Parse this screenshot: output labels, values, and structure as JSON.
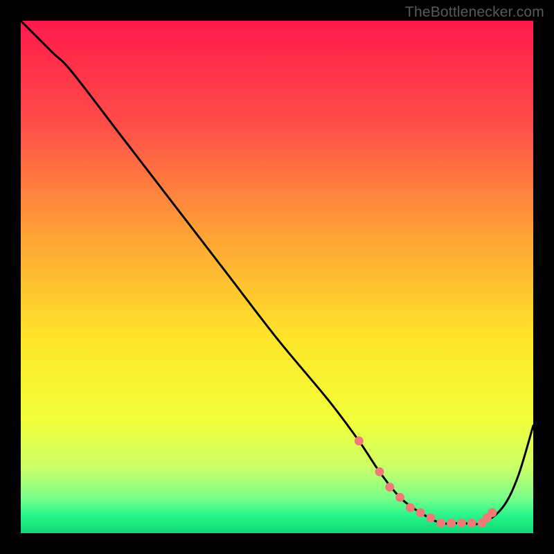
{
  "attribution": "TheBottlenecker.com",
  "colors": {
    "black": "#000000",
    "curve": "#000000",
    "dot": "#ee7b78"
  },
  "chart_data": {
    "type": "line",
    "title": "",
    "xlabel": "",
    "ylabel": "",
    "xlim": [
      0,
      100
    ],
    "ylim": [
      0,
      100
    ],
    "grid": false,
    "legend": false,
    "gradient_stops": [
      {
        "pos": 0.0,
        "color": "#ff1a4b"
      },
      {
        "pos": 0.2,
        "color": "#ff4d49"
      },
      {
        "pos": 0.42,
        "color": "#ffa336"
      },
      {
        "pos": 0.62,
        "color": "#ffe52a"
      },
      {
        "pos": 0.78,
        "color": "#f2ff3a"
      },
      {
        "pos": 0.87,
        "color": "#ccff66"
      },
      {
        "pos": 0.93,
        "color": "#7dff8a"
      },
      {
        "pos": 0.965,
        "color": "#29f58b"
      },
      {
        "pos": 1.0,
        "color": "#0fd876"
      }
    ],
    "series": [
      {
        "name": "bottleneck-curve",
        "x": [
          0,
          6,
          10,
          20,
          30,
          40,
          50,
          60,
          66,
          70,
          74,
          78,
          82,
          86,
          90,
          94,
          97,
          100
        ],
        "y": [
          100,
          94,
          90,
          77,
          64,
          51,
          38,
          26,
          18,
          12,
          7,
          4,
          2,
          2,
          2,
          5,
          11,
          21
        ]
      }
    ],
    "markers": {
      "name": "highlighted-points",
      "x": [
        66,
        70,
        72,
        74,
        76,
        78,
        80,
        82,
        84,
        86,
        88,
        90,
        91,
        92
      ],
      "y": [
        18,
        12,
        9,
        7,
        5,
        4,
        3,
        2,
        2,
        2,
        2,
        2,
        3,
        4
      ]
    }
  }
}
